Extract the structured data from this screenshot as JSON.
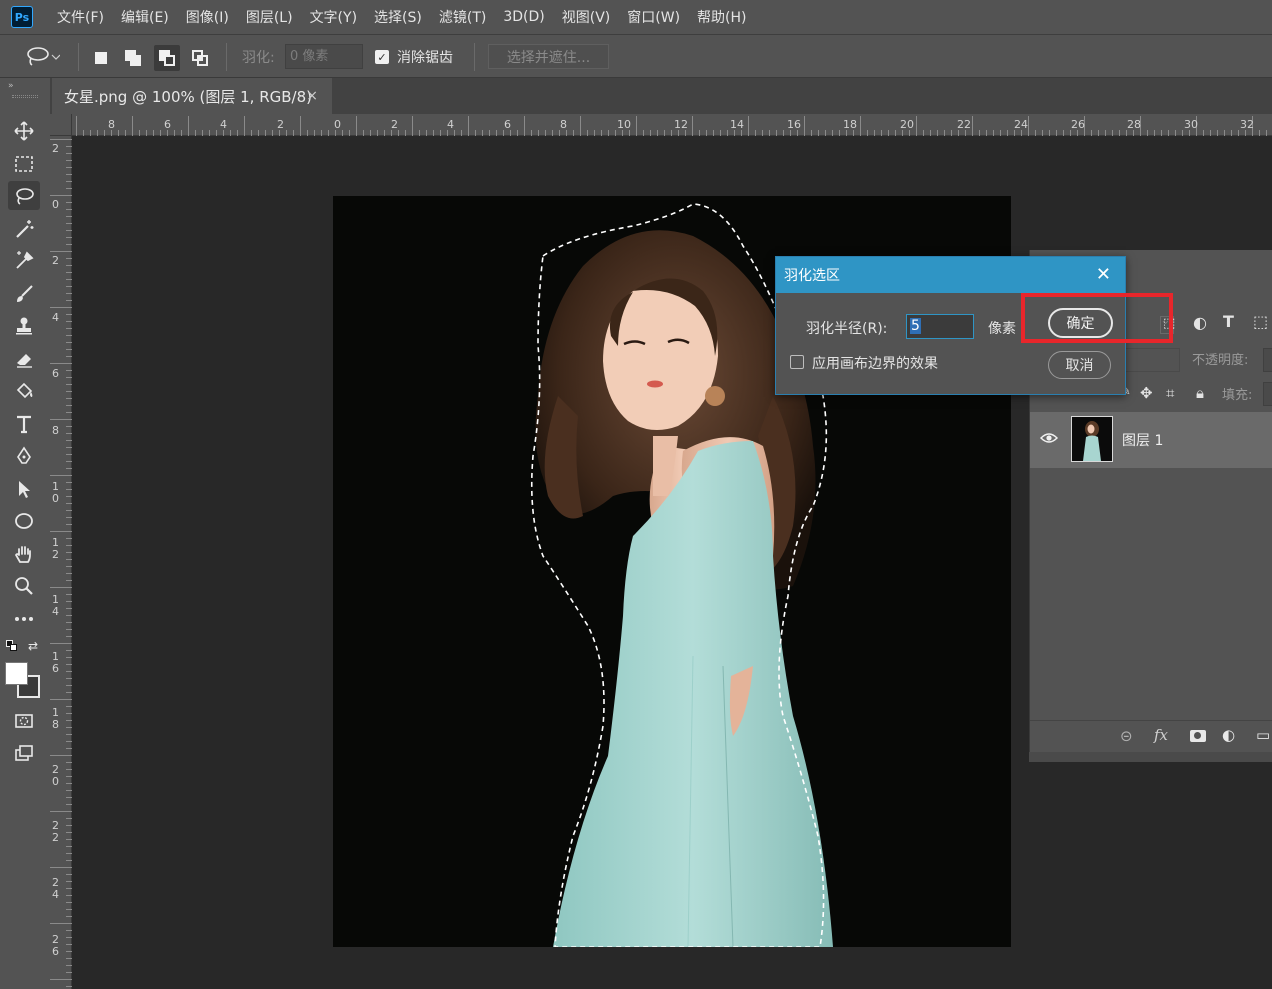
{
  "app": {
    "logo": "Ps"
  },
  "menubar": {
    "items": [
      "文件(F)",
      "编辑(E)",
      "图像(I)",
      "图层(L)",
      "文字(Y)",
      "选择(S)",
      "滤镜(T)",
      "3D(D)",
      "视图(V)",
      "窗口(W)",
      "帮助(H)"
    ]
  },
  "options": {
    "tool_icon": "lasso-icon",
    "feather_label": "羽化:",
    "feather_placeholder": "0 像素",
    "antialias_label": "消除锯齿",
    "antialias_checked": true,
    "select_mask_label": "选择并遮住..."
  },
  "document": {
    "tab_title": "女星.png @ 100% (图层 1, RGB/8)",
    "tab_close": "×"
  },
  "rulers": {
    "horizontal": [
      "8",
      "6",
      "4",
      "2",
      "0",
      "2",
      "4",
      "6",
      "8",
      "10",
      "12",
      "14",
      "16",
      "18",
      "20",
      "22",
      "24",
      "26",
      "28",
      "30",
      "32"
    ],
    "vertical": [
      "2",
      "0",
      "2",
      "4",
      "6",
      "8",
      "10",
      "12",
      "14",
      "16",
      "18",
      "20",
      "22",
      "24",
      "26"
    ]
  },
  "toolbar": {
    "tools": [
      "move-icon",
      "marquee-icon",
      "lasso-icon",
      "magic-wand-icon",
      "eyedropper-icon",
      "brush-icon",
      "stamp-icon",
      "eraser-icon",
      "paint-bucket-icon",
      "type-icon",
      "pen-icon",
      "path-select-icon",
      "ellipse-icon",
      "hand-icon",
      "zoom-icon",
      "more-tools-icon"
    ],
    "active_tool": "lasso-icon"
  },
  "layers_panel": {
    "opacity_label": "不透明度:",
    "fill_label": "填充:",
    "layer_name": "图层 1",
    "footer_icons": [
      "link-icon",
      "fx-icon",
      "mask-icon",
      "adjustment-icon",
      "folder-icon"
    ]
  },
  "dialog": {
    "title": "羽化选区",
    "close": "✕",
    "radius_label": "羽化半径(R):",
    "radius_value": "5",
    "radius_unit": "像素",
    "ok_label": "确定",
    "cancel_label": "取消",
    "edge_label": "应用画布边界的效果",
    "edge_checked": false
  },
  "colors": {
    "accent": "#2f95c5",
    "highlight": "#e8262b",
    "panel": "#535353",
    "workspace": "#282828",
    "dress": "#a8d5d0"
  }
}
